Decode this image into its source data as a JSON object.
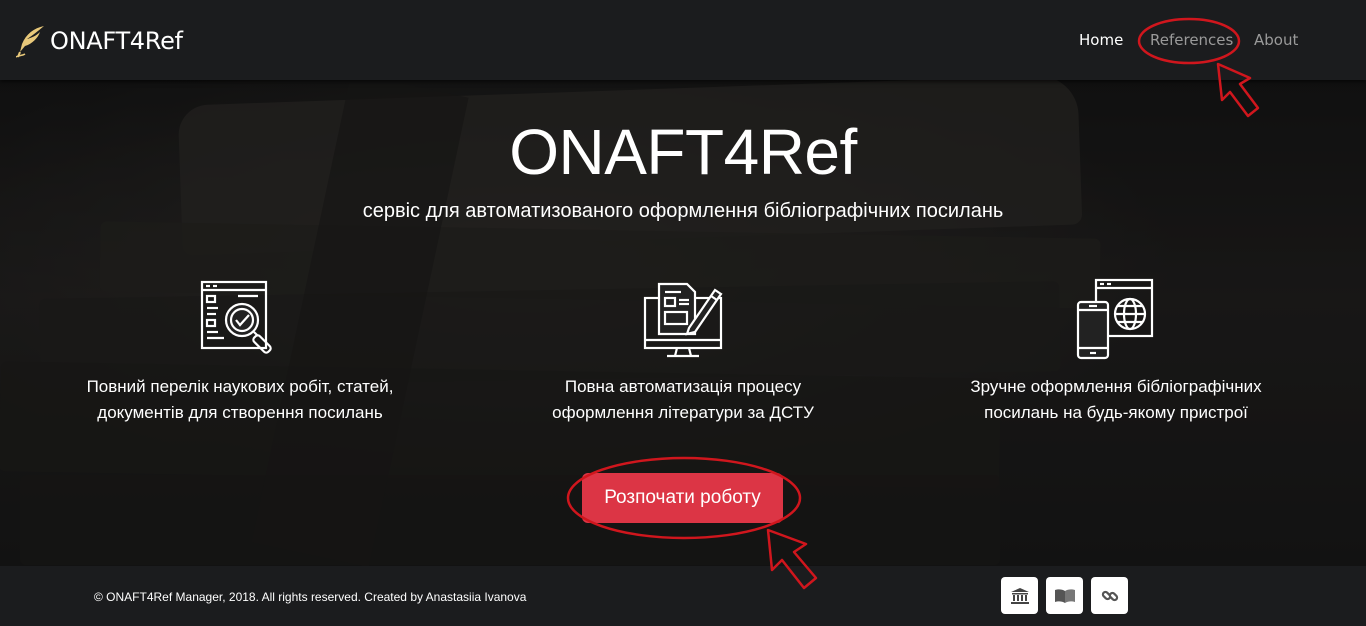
{
  "navbar": {
    "brand": "ONAFT4Ref",
    "links": {
      "home": "Home",
      "references": "References",
      "about": "About"
    }
  },
  "hero": {
    "title": "ONAFT4Ref",
    "subtitle": "сервіс для автоматизованого оформлення бібліографічних посилань",
    "features": [
      {
        "icon": "document-search-icon",
        "text": "Повний перелік наукових робіт, статей, документів для створення посилань"
      },
      {
        "icon": "monitor-edit-icon",
        "text": "Повна автоматизація процесу оформлення літератури за ДСТУ"
      },
      {
        "icon": "mobile-web-icon",
        "text": "Зручне оформлення бібліографічних посилань на будь-якому пристрої"
      }
    ],
    "cta": "Розпочати роботу"
  },
  "footer": {
    "copyright": "© ONAFT4Ref Manager, 2018. All rights reserved. Created by Anastasiia Ivanova",
    "buttons": [
      "institution-icon",
      "book-icon",
      "link-icon"
    ]
  },
  "colors": {
    "accent": "#dc3545",
    "navbar": "#1b1c1e",
    "annotation": "#d0161d"
  }
}
